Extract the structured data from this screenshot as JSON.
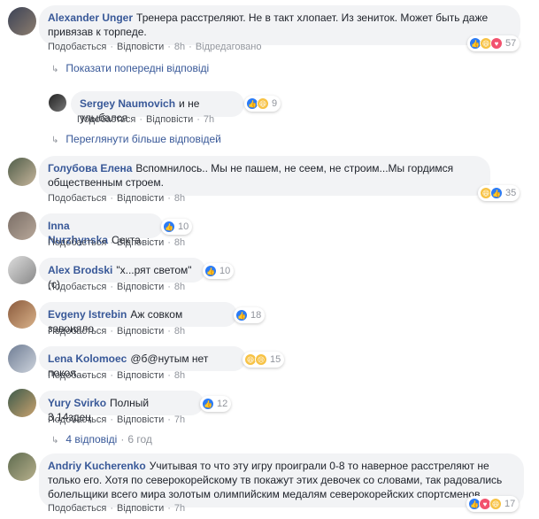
{
  "labels": {
    "like": "Подобається",
    "reply": "Відповісти",
    "edited": "Відредаговано",
    "sep": "·"
  },
  "comments": [
    {
      "author": "Alexander Unger",
      "text": "Тренера расстреляют. Не в такт хлопает. Из зениток. Может быть даже привязав к торпеде.",
      "time": "8h",
      "edited": true,
      "reactions": {
        "count": "57",
        "icons": [
          "like",
          "haha",
          "love"
        ]
      }
    },
    {
      "author": "Sergey Naumovich",
      "text": "и не улыбался",
      "time": "7h",
      "reactions": {
        "count": "9",
        "icons": [
          "like",
          "haha"
        ]
      }
    },
    {
      "author": "Голубова Елена",
      "text": "Вспомнилось.. Мы не пашем, не сеем, не строим...Мы гордимся общественным строем.",
      "time": "8h",
      "reactions": {
        "count": "35",
        "icons": [
          "haha",
          "like"
        ]
      }
    },
    {
      "author": "Inna Nurzhynska",
      "text": "Секта",
      "time": "8h",
      "reactions": {
        "count": "10",
        "icons": [
          "like"
        ]
      }
    },
    {
      "author": "Alex Brodski",
      "text": "\"х...рят светом\" (с)",
      "time": "8h",
      "reactions": {
        "count": "10",
        "icons": [
          "like"
        ]
      }
    },
    {
      "author": "Evgeny Istrebin",
      "text": "Аж совком завоняло.",
      "time": "8h",
      "reactions": {
        "count": "18",
        "icons": [
          "like"
        ]
      }
    },
    {
      "author": "Lena Kolomoec",
      "text": "@б@нутым нет покоя....",
      "time": "8h",
      "reactions": {
        "count": "15",
        "icons": [
          "haha",
          "sad"
        ]
      }
    },
    {
      "author": "Yury Svirko",
      "text": "Полный 3.14здец",
      "time": "7h",
      "reactions": {
        "count": "12",
        "icons": [
          "like"
        ]
      }
    },
    {
      "author": "Andriy Kucherenko",
      "text": "Учитывая то что эту игру проиграли 0-8 то наверное расстреляют не только его. Хотя по северокорейскому тв покажут этих девочек со словами, так радовались болельщики всего мира золотым олимпийским медалям северокорейских спортсменов.",
      "time": "7h",
      "reactions": {
        "count": "17",
        "icons": [
          "like",
          "love",
          "haha"
        ]
      }
    }
  ],
  "more_links": {
    "prev_replies": "Показати попередні відповіді",
    "more_replies": "Переглянути більше відповідей",
    "replies_count": "4 відповіді",
    "replies_time": "6 год"
  },
  "colors": {
    "link": "#385898",
    "bubble": "#f2f3f5",
    "meta": "#90949c",
    "like": "#2a7bf6",
    "haha": "#f7c244",
    "love": "#f2526e"
  }
}
